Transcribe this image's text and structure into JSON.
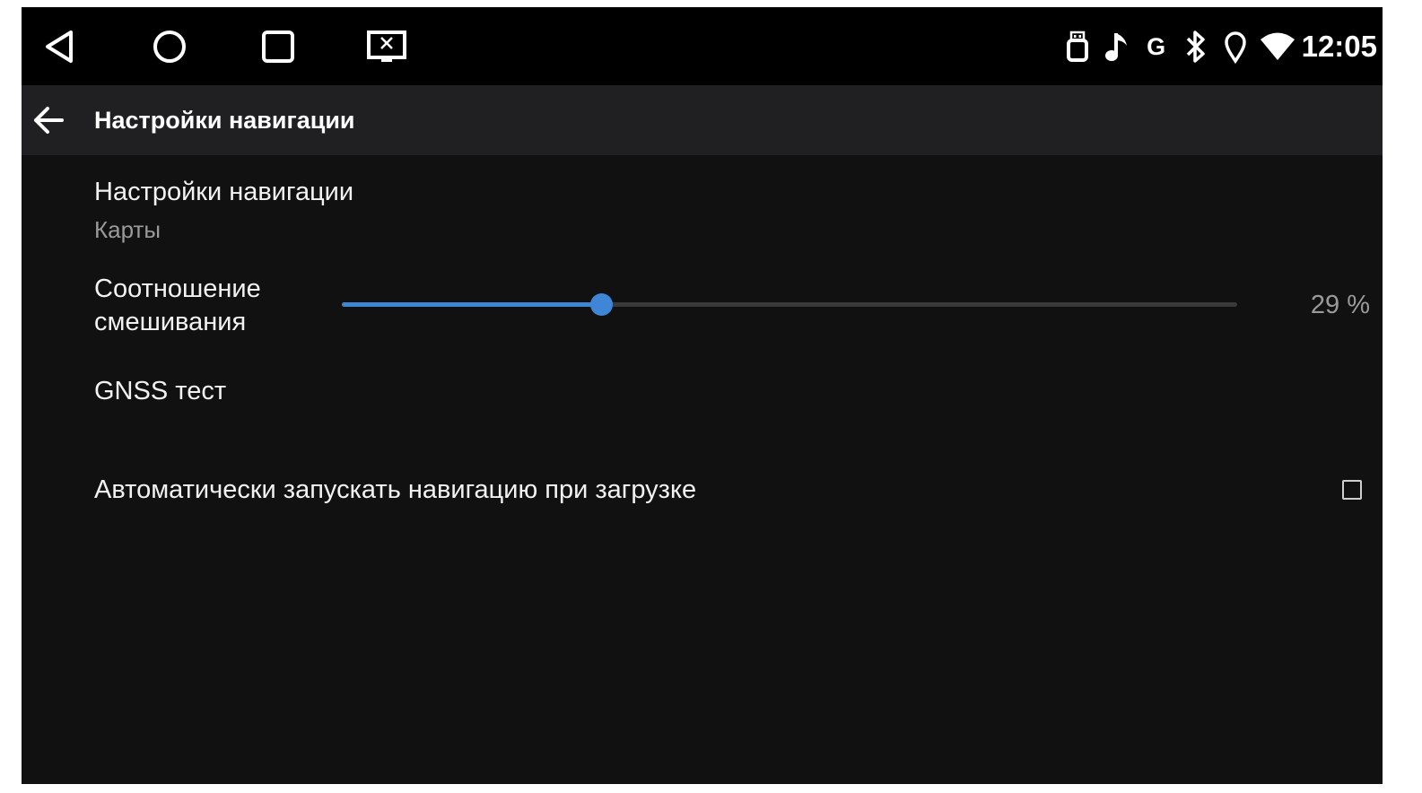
{
  "statusbar": {
    "clock": "12:05",
    "status_icons": [
      "usb-icon",
      "music-note-icon",
      "g-icon",
      "bluetooth-icon",
      "location-icon",
      "wifi-icon"
    ],
    "g_label": "G",
    "nav_icons": [
      "back-triangle-icon",
      "home-circle-icon",
      "recents-square-icon",
      "screen-close-icon"
    ]
  },
  "toolbar": {
    "title": "Настройки навигации"
  },
  "preferences": {
    "nav_settings": {
      "title": "Настройки навигации",
      "summary": "Карты"
    },
    "mix_ratio": {
      "title_line1": "Соотношение",
      "title_line2": "смешивания",
      "value": 29,
      "value_label": "29 %"
    },
    "gnss": {
      "title": "GNSS тест"
    },
    "autostart": {
      "title": "Автоматически запускать навигацию при загрузке",
      "checked": false
    }
  },
  "colors": {
    "accent": "#3f86d6",
    "background": "#111112",
    "toolbar": "#202022",
    "statusbar": "#000000"
  }
}
